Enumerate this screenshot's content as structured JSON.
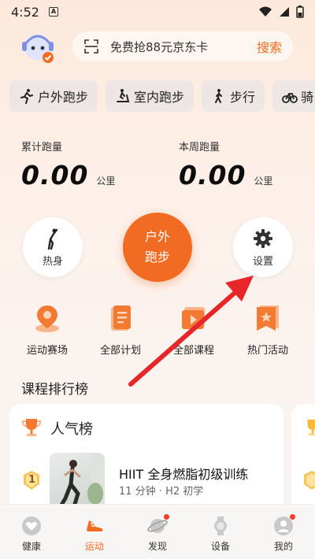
{
  "status": {
    "time": "4:52",
    "a_badge": "A"
  },
  "search": {
    "placeholder": "免费抢88元京东卡",
    "button": "搜索"
  },
  "chips": [
    {
      "label": "户外跑步",
      "icon": "run-icon"
    },
    {
      "label": "室内跑步",
      "icon": "treadmill-icon"
    },
    {
      "label": "步行",
      "icon": "walk-icon"
    },
    {
      "label": "骑",
      "icon": "bike-icon"
    }
  ],
  "stats": {
    "total_label": "累计跑量",
    "total_value": "0.00",
    "total_unit": "公里",
    "week_label": "本周跑量",
    "week_value": "0.00",
    "week_unit": "公里"
  },
  "actions": {
    "warmup": "热身",
    "start_line1": "户外",
    "start_line2": "跑步",
    "settings": "设置"
  },
  "features": [
    {
      "label": "运动赛场",
      "icon": "location-pin-icon"
    },
    {
      "label": "全部计划",
      "icon": "clipboard-icon"
    },
    {
      "label": "全部课程",
      "icon": "video-icon"
    },
    {
      "label": "热门活动",
      "icon": "star-flag-icon"
    }
  ],
  "ranking": {
    "section_title": "课程排行榜",
    "card_title": "人气榜",
    "items": [
      {
        "rank": "1",
        "name": "HIIT 全身燃脂初级训练",
        "meta": "11 分钟 · H2 初学"
      }
    ]
  },
  "tabs": [
    {
      "label": "健康",
      "icon": "heart-icon"
    },
    {
      "label": "运动",
      "icon": "shoe-icon"
    },
    {
      "label": "发现",
      "icon": "planet-icon"
    },
    {
      "label": "设备",
      "icon": "watch-icon"
    },
    {
      "label": "我的",
      "icon": "person-icon"
    }
  ],
  "colors": {
    "accent": "#f26b22",
    "annotation_arrow": "#e8262a"
  }
}
